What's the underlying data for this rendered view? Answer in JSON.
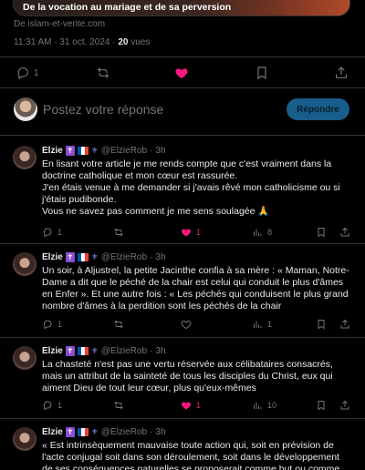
{
  "link_card": {
    "caption": "De la vocation au mariage et de sa perversion",
    "source": "De islam-et-verite.com"
  },
  "post_meta": {
    "time": "11:31 AM",
    "date": "31 oct. 2024",
    "views_count": "20",
    "views_label": "vues"
  },
  "post_actions": {
    "replies": "1",
    "reposts": "",
    "likes": "",
    "bookmarks": ""
  },
  "compose": {
    "placeholder": "Postez votre réponse",
    "reply_button": "Répondre"
  },
  "colors": {
    "like_pink": "#f91880",
    "reply_button": "#1d6fa3",
    "cross_badge": "#8a4fd1"
  },
  "replies": [
    {
      "name": "Elzie",
      "handle": "@ElzieRob",
      "time": "3h",
      "paragraphs": [
        "En lisant votre article je me rends compte que c'est vraiment dans la doctrine catholique et mon cœur est rassurée.",
        "J'en étais venue à me demander si j'avais rêvé mon catholicisme ou si j'étais pudibonde.",
        "Vous ne savez pas comment je me sens soulagée 🙏"
      ],
      "stats": {
        "replies": "1",
        "reposts": "",
        "likes": "1",
        "views": "8"
      }
    },
    {
      "name": "Elzie",
      "handle": "@ElzieRob",
      "time": "3h",
      "paragraphs": [
        "Un soir, à Aljustrel, la petite Jacinthe confia à sa mère : « Maman, Notre-Dame a dit que le péché de la chair est celui qui conduit le plus d'âmes en Enfer ». Et une autre fois : « Les péchés qui conduisent le plus grand nombre d'âmes à la perdition sont les péchés de la chair"
      ],
      "stats": {
        "replies": "1",
        "reposts": "",
        "likes": "",
        "views": "1"
      }
    },
    {
      "name": "Elzie",
      "handle": "@ElzieRob",
      "time": "3h",
      "paragraphs": [
        "La chasteté n'est pas une vertu réservée aux célibataires consacrés, mais un attribut de la sainteté de tous les disciples du Christ, eux qui aiment Dieu de tout leur cœur, plus qu'eux-mêmes"
      ],
      "stats": {
        "replies": "1",
        "reposts": "",
        "likes": "1",
        "views": "10"
      }
    },
    {
      "name": "Elzie",
      "handle": "@ElzieRob",
      "time": "3h",
      "paragraphs": [
        "« Est intrinsèquement mauvaise toute action qui, soit en prévision de l'acte conjugal soit dans son déroulement, soit dans le développement de ses conséquences naturelles se proposerait comme but ou comme moyen de"
      ],
      "stats": {
        "replies": "",
        "reposts": "",
        "likes": "",
        "views": ""
      }
    }
  ]
}
